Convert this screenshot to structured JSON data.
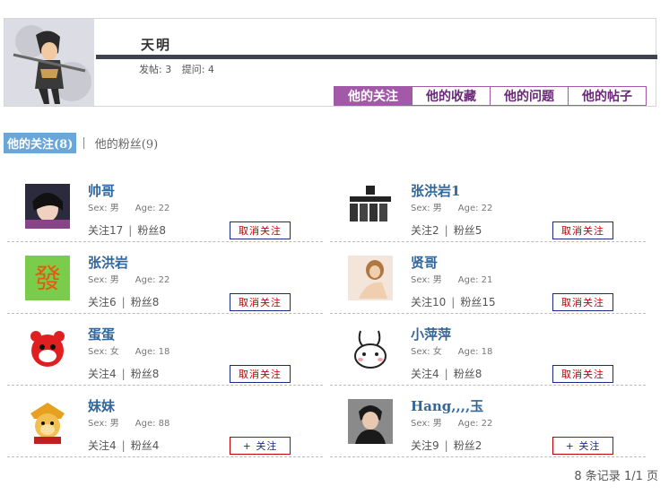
{
  "profile": {
    "name": "天明",
    "posts_label": "发帖: 3",
    "questions_label": "提问: 4"
  },
  "tabs": [
    "他的关注",
    "他的收藏",
    "他的问题",
    "他的帖子"
  ],
  "subtabs": {
    "following": "他的关注(8)",
    "fans": "他的粉丝(9)"
  },
  "users": [
    {
      "name": "帅哥",
      "sex": "Sex: 男",
      "age": "Age: 22",
      "follow": "关注17",
      "fans": "粉丝8",
      "button": "取消关注",
      "avatar_icon": "boy-portrait-icon",
      "avatar_color": "#2a2a3a"
    },
    {
      "name": "张洪岩1",
      "sex": "Sex: 男",
      "age": "Age: 22",
      "follow": "关注2",
      "fans": "粉丝5",
      "button": "取消关注",
      "avatar_icon": "poster-icon",
      "avatar_color": "#444444"
    },
    {
      "name": "张洪岩",
      "sex": "Sex: 男",
      "age": "Age: 22",
      "follow": "关注6",
      "fans": "粉丝8",
      "button": "取消关注",
      "avatar_icon": "fortune-character-icon",
      "avatar_color": "#6cc24a"
    },
    {
      "name": "贤哥",
      "sex": "Sex: 男",
      "age": "Age: 21",
      "follow": "关注10",
      "fans": "粉丝15",
      "button": "取消关注",
      "avatar_icon": "girl-photo-icon",
      "avatar_color": "#d9b49a"
    },
    {
      "name": "蛋蛋",
      "sex": "Sex: 女",
      "age": "Age: 18",
      "follow": "关注4",
      "fans": "粉丝8",
      "button": "取消关注",
      "avatar_icon": "red-cartoon-icon",
      "avatar_color": "#e02020"
    },
    {
      "name": "小萍萍",
      "sex": "Sex: 女",
      "age": "Age: 18",
      "follow": "关注4",
      "fans": "粉丝8",
      "button": "取消关注",
      "avatar_icon": "rabbit-icon",
      "avatar_color": "#ffffff"
    },
    {
      "name": "妹妹",
      "sex": "Sex: 男",
      "age": "Age: 88",
      "follow": "关注4",
      "fans": "粉丝4",
      "button": "+ 关注",
      "avatar_icon": "monkey-king-icon",
      "avatar_color": "#e8a020"
    },
    {
      "name": "Hang,,,,玉",
      "sex": "Sex: 男",
      "age": "Age: 22",
      "follow": "关注9",
      "fans": "粉丝2",
      "button": "+ 关注",
      "avatar_icon": "man-photo-icon",
      "avatar_color": "#555555"
    }
  ],
  "footer": "8 条记录 1/1 页"
}
